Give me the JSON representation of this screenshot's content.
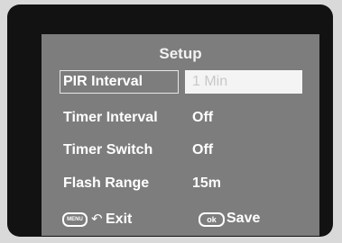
{
  "screen": {
    "title": "Setup",
    "rows": [
      {
        "label": "PIR Interval",
        "value": "1 Min"
      },
      {
        "label": "Timer Interval",
        "value": "Off"
      },
      {
        "label": "Timer Switch",
        "value": "Off"
      },
      {
        "label": "Flash Range",
        "value": "15m"
      }
    ]
  },
  "footer": {
    "menu_key": "MENU",
    "exit_label": "Exit",
    "ok_key": "ok",
    "save_label": "Save"
  },
  "colors": {
    "bezel": "#121212",
    "screen": "#7d7d7d",
    "text": "#ffffff",
    "selected_value_bg": "#f4f4f4"
  }
}
